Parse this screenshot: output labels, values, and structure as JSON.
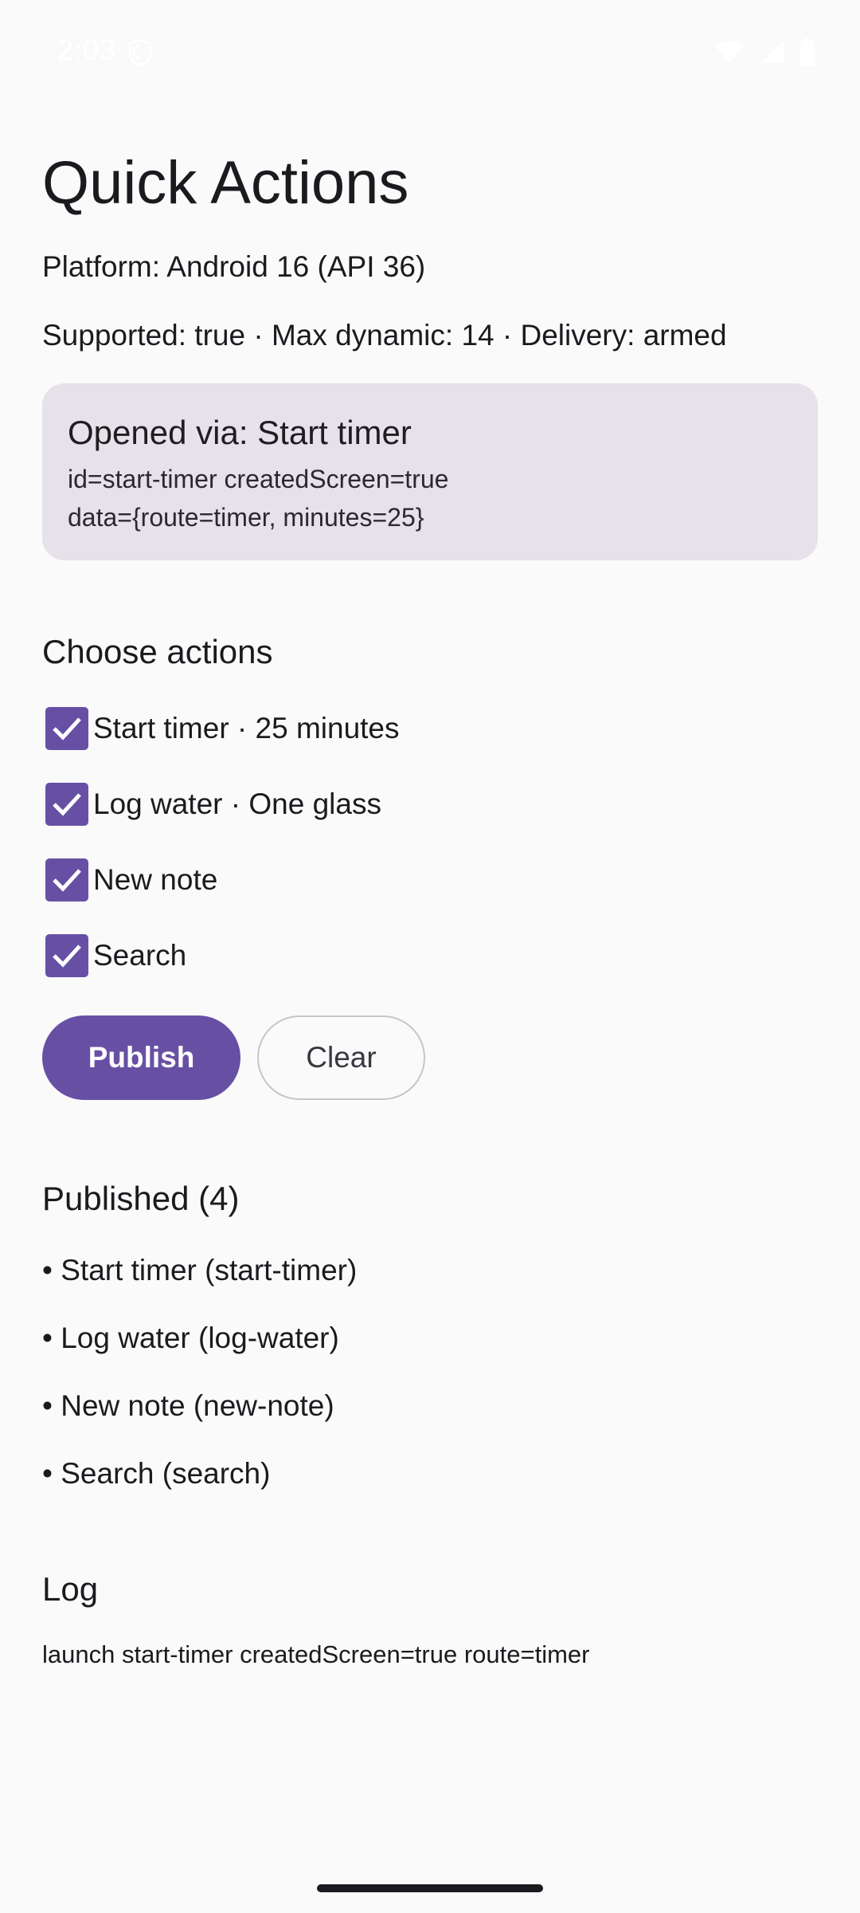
{
  "status_bar": {
    "time": "2:03",
    "icons": [
      "shield-icon",
      "wifi-icon",
      "signal-icon",
      "battery-icon"
    ]
  },
  "header": {
    "title": "Quick Actions"
  },
  "info": {
    "platform": "Platform: Android 16 (API 36)",
    "support": "Supported: true · Max dynamic: 14 · Delivery: armed"
  },
  "opened": {
    "title": "Opened via: Start timer",
    "line1": "id=start-timer createdScreen=true",
    "line2": "data={route=timer, minutes=25}"
  },
  "choose": {
    "heading": "Choose actions",
    "items": [
      {
        "label": "Start timer · 25 minutes",
        "checked": true
      },
      {
        "label": "Log water · One glass",
        "checked": true
      },
      {
        "label": "New note",
        "checked": true
      },
      {
        "label": "Search",
        "checked": true
      }
    ]
  },
  "buttons": {
    "publish": "Publish",
    "clear": "Clear"
  },
  "published": {
    "heading": "Published (4)",
    "items": [
      "• Start timer (start-timer)",
      "• Log water (log-water)",
      "• New note (new-note)",
      "• Search (search)"
    ]
  },
  "log": {
    "heading": "Log",
    "entries": [
      "launch start-timer createdScreen=true route=timer"
    ]
  },
  "colors": {
    "accent": "#6750a4",
    "card_bg": "#e7e1e9",
    "page_bg": "#fafafb"
  }
}
